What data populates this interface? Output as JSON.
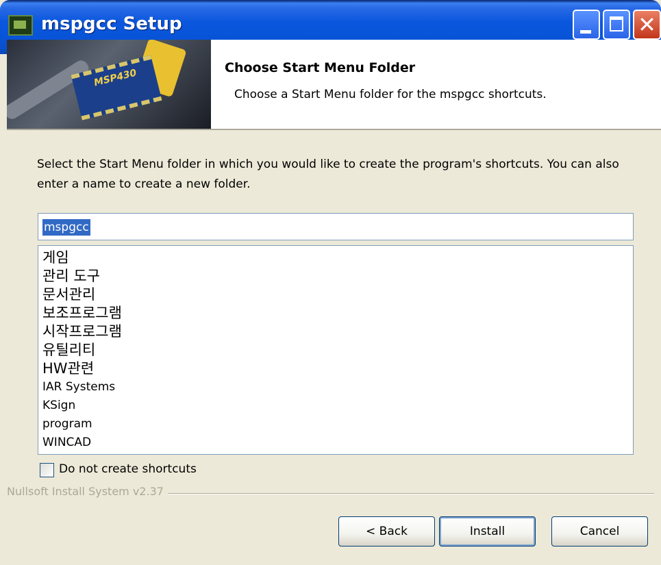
{
  "window": {
    "title": "mspgcc Setup"
  },
  "header": {
    "title": "Choose Start Menu Folder",
    "subtitle": "Choose a Start Menu folder for the mspgcc shortcuts.",
    "banner_chip_text": "MSP430"
  },
  "instructions": "Select the Start Menu folder in which you would like to create the program's shortcuts. You can also enter a name to create a new folder.",
  "folder_input": {
    "value": "mspgcc"
  },
  "folder_list": {
    "items": [
      {
        "label": "게임"
      },
      {
        "label": "관리 도구"
      },
      {
        "label": "문서관리"
      },
      {
        "label": "보조프로그램"
      },
      {
        "label": "시작프로그램"
      },
      {
        "label": "유틸리티"
      },
      {
        "label": "HW관련"
      },
      {
        "label": "IAR Systems"
      },
      {
        "label": "KSign"
      },
      {
        "label": "program"
      },
      {
        "label": "WINCAD"
      }
    ]
  },
  "checkbox": {
    "label": "Do not create shortcuts",
    "checked": false
  },
  "branding": "Nullsoft Install System v2.37",
  "buttons": {
    "back": "< Back",
    "install": "Install",
    "cancel": "Cancel"
  },
  "colors": {
    "titlebar": "#0a57de",
    "face": "#ece9d8",
    "selection": "#316ac5",
    "close": "#c3361b"
  }
}
